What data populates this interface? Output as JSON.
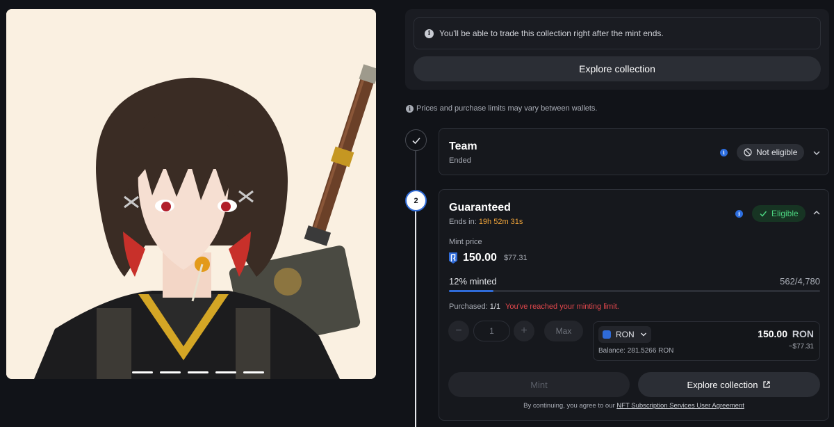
{
  "artwork": {
    "slide_count": 5
  },
  "notice": {
    "text": "You'll be able to trade this collection right after the mint ends.",
    "explore_label": "Explore collection"
  },
  "prices_note": "Prices and purchase limits may vary between wallets.",
  "phases": {
    "team": {
      "step": "",
      "title": "Team",
      "status": "Ended",
      "badge": "Not eligible"
    },
    "guaranteed": {
      "step": "2",
      "title": "Guaranteed",
      "ends_label": "Ends in:",
      "ends_value": "19h 52m 31s",
      "badge": "Eligible",
      "mint_price_label": "Mint price",
      "price": "150.00",
      "price_usd": "$77.31",
      "minted_label": "12% minted",
      "minted_fraction": 0.12,
      "minted_count": "562/4,780",
      "purchased_label": "Purchased:",
      "purchased_value": "1/1",
      "limit_message": "You've reached your minting limit.",
      "quantity": "1",
      "minus": "−",
      "plus": "+",
      "max_label": "Max",
      "token": "RON",
      "balance": "Balance: 281.5266 RON",
      "pay_amount": "150.00",
      "pay_currency": "RON",
      "pay_usd": "~$77.31",
      "mint_label": "Mint",
      "explore_label": "Explore collection",
      "agree_prefix": "By continuing, you agree to our",
      "agree_link": "NFT Subscription Services User Agreement"
    }
  },
  "colors": {
    "accent_blue": "#2f6bd8",
    "eligible_green": "#4bd27f",
    "warning_red": "#e5484d",
    "countdown_orange": "#f0a43a"
  }
}
